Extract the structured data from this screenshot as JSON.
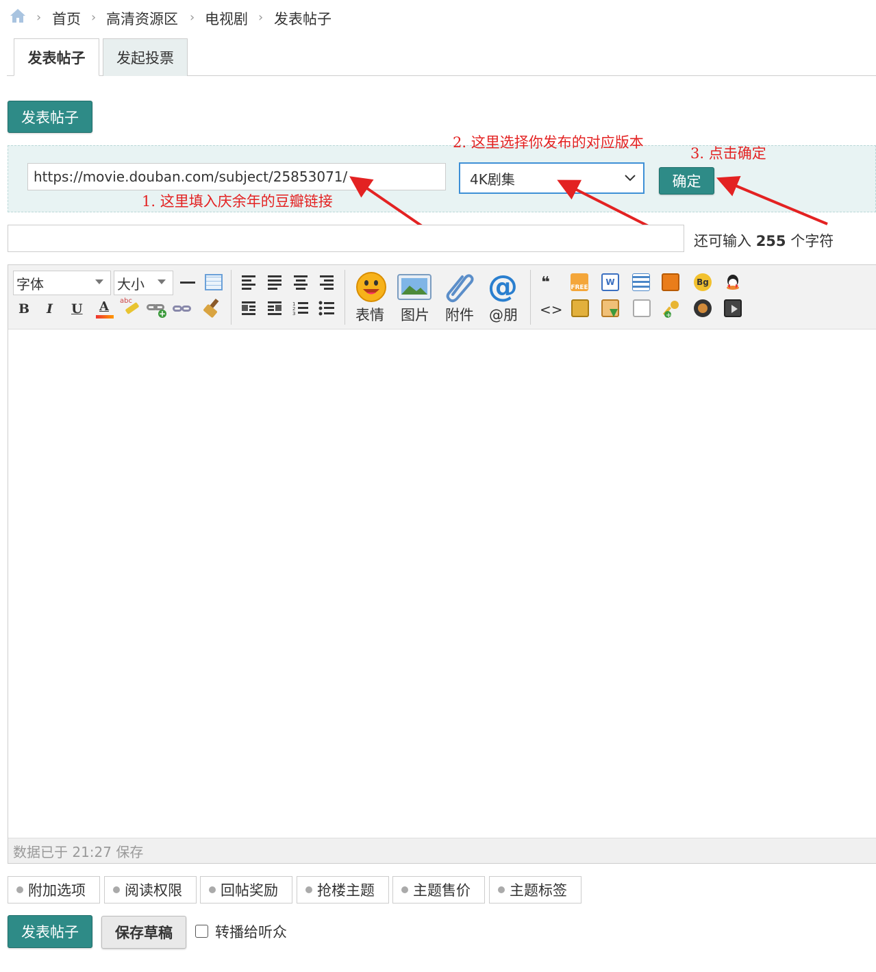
{
  "breadcrumb": {
    "items": [
      "首页",
      "高清资源区",
      "电视剧",
      "发表帖子"
    ],
    "separator": "›"
  },
  "tabs": [
    {
      "label": "发表帖子",
      "active": true
    },
    {
      "label": "发起投票",
      "active": false
    }
  ],
  "top_post_button": "发表帖子",
  "douban": {
    "url_value": "https://movie.douban.com/subject/25853071/",
    "select_value": "4K剧集",
    "confirm_label": "确定"
  },
  "annotations": {
    "step1": "1. 这里填入庆余年的豆瓣链接",
    "step2": "2. 这里选择你发布的对应版本",
    "step3": "3. 点击确定"
  },
  "title_input": {
    "value": "",
    "remaining_prefix": "还可输入",
    "remaining_count": "255",
    "remaining_suffix": "个字符"
  },
  "toolbar": {
    "font_label": "字体",
    "size_label": "大小",
    "big_buttons": [
      "表情",
      "图片",
      "附件",
      "@朋"
    ]
  },
  "status": "数据已于 21:27 保存",
  "options": [
    "附加选项",
    "阅读权限",
    "回帖奖励",
    "抢楼主题",
    "主题售价",
    "主题标签"
  ],
  "footer": {
    "submit_label": "发表帖子",
    "draft_label": "保存草稿",
    "broadcast_label": "转播给听众",
    "broadcast_checked": false
  },
  "colors": {
    "primary": "#2e8b87",
    "annotation": "#e32222"
  }
}
